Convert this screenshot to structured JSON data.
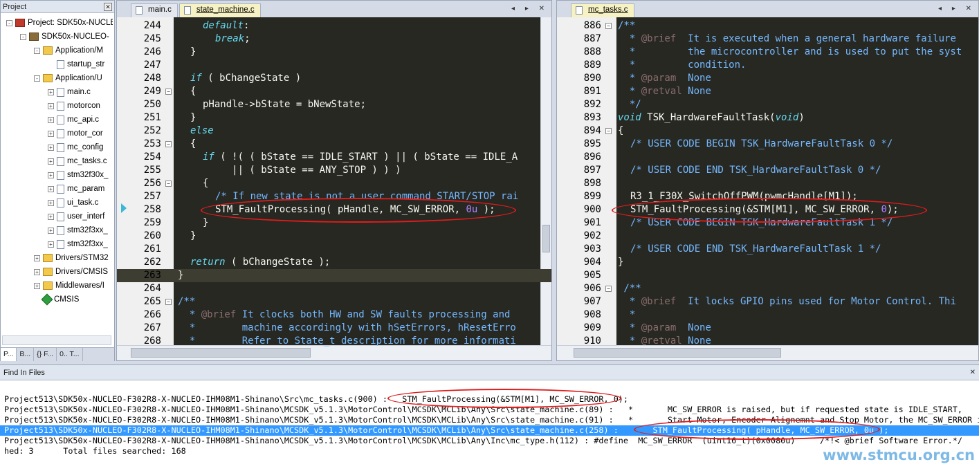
{
  "project_panel": {
    "title": "Project",
    "tree": [
      {
        "label": "Project: SDK50x-NUCLE",
        "depth": 0,
        "exp": "-",
        "icon": "proj"
      },
      {
        "label": "SDK50x-NUCLEO-",
        "depth": 1,
        "exp": "-",
        "icon": "target"
      },
      {
        "label": "Application/M",
        "depth": 2,
        "exp": "-",
        "icon": "folder"
      },
      {
        "label": "startup_str",
        "depth": 3,
        "exp": "",
        "icon": "file"
      },
      {
        "label": "Application/U",
        "depth": 2,
        "exp": "-",
        "icon": "folder"
      },
      {
        "label": "main.c",
        "depth": 3,
        "exp": "+",
        "icon": "file"
      },
      {
        "label": "motorcon",
        "depth": 3,
        "exp": "+",
        "icon": "file"
      },
      {
        "label": "mc_api.c",
        "depth": 3,
        "exp": "+",
        "icon": "file"
      },
      {
        "label": "motor_cor",
        "depth": 3,
        "exp": "+",
        "icon": "file"
      },
      {
        "label": "mc_config",
        "depth": 3,
        "exp": "+",
        "icon": "file"
      },
      {
        "label": "mc_tasks.c",
        "depth": 3,
        "exp": "+",
        "icon": "file"
      },
      {
        "label": "stm32f30x_",
        "depth": 3,
        "exp": "+",
        "icon": "file"
      },
      {
        "label": "mc_param",
        "depth": 3,
        "exp": "+",
        "icon": "file"
      },
      {
        "label": "ui_task.c",
        "depth": 3,
        "exp": "+",
        "icon": "file"
      },
      {
        "label": "user_interf",
        "depth": 3,
        "exp": "+",
        "icon": "file"
      },
      {
        "label": "stm32f3xx_",
        "depth": 3,
        "exp": "+",
        "icon": "file"
      },
      {
        "label": "stm32f3xx_",
        "depth": 3,
        "exp": "+",
        "icon": "file"
      },
      {
        "label": "Drivers/STM32",
        "depth": 2,
        "exp": "+",
        "icon": "folder"
      },
      {
        "label": "Drivers/CMSIS",
        "depth": 2,
        "exp": "+",
        "icon": "folder"
      },
      {
        "label": "Middlewares/I",
        "depth": 2,
        "exp": "+",
        "icon": "folder"
      },
      {
        "label": "CMSIS",
        "depth": 2,
        "exp": "",
        "icon": "gem"
      }
    ],
    "bottom_tabs": [
      "P...",
      "B...",
      "{} F...",
      "0.. T..."
    ]
  },
  "left_editor": {
    "tabs": [
      {
        "label": "main.c",
        "active": false
      },
      {
        "label": "state_machine.c",
        "active": true
      }
    ],
    "lines": [
      {
        "n": "244",
        "f": "",
        "h": "<span class='kw'>default</span>:",
        "i": 2
      },
      {
        "n": "245",
        "f": "",
        "h": "<span class='kw'>break</span>;",
        "i": 3
      },
      {
        "n": "246",
        "f": "",
        "h": "}",
        "i": 1
      },
      {
        "n": "247",
        "f": "",
        "h": "",
        "i": 0
      },
      {
        "n": "248",
        "f": "",
        "h": "<span class='kw'>if</span> ( bChangeState )",
        "i": 1
      },
      {
        "n": "249",
        "f": "-",
        "h": "{",
        "i": 1
      },
      {
        "n": "250",
        "f": "",
        "h": "pHandle-&gt;bState = bNewState;",
        "i": 2
      },
      {
        "n": "251",
        "f": "",
        "h": "}",
        "i": 1
      },
      {
        "n": "252",
        "f": "",
        "h": "<span class='kw'>else</span>",
        "i": 1
      },
      {
        "n": "253",
        "f": "-",
        "h": "{",
        "i": 1
      },
      {
        "n": "254",
        "f": "",
        "h": "<span class='kw'>if</span> ( !( ( bState == IDLE_START ) || ( bState == IDLE_A",
        "i": 2
      },
      {
        "n": "255",
        "f": "",
        "h": "     || ( bState == ANY_STOP ) ) )",
        "i": 2
      },
      {
        "n": "256",
        "f": "-",
        "h": "{",
        "i": 2
      },
      {
        "n": "257",
        "f": "",
        "h": "<span class='cm'>/* If new state is not a user command START/STOP rai</span>",
        "i": 3
      },
      {
        "n": "258",
        "f": "",
        "h": "STM_FaultProcessing( pHandle, MC_SW_ERROR, <span class='num'>0u</span> );",
        "i": 3
      },
      {
        "n": "259",
        "f": "",
        "h": "}",
        "i": 2
      },
      {
        "n": "260",
        "f": "",
        "h": "}",
        "i": 1
      },
      {
        "n": "261",
        "f": "",
        "h": "",
        "i": 0
      },
      {
        "n": "262",
        "f": "",
        "h": "<span class='kw'>return</span> ( bChangeState );",
        "i": 1
      },
      {
        "n": "263",
        "f": "",
        "h": "}",
        "i": 0
      },
      {
        "n": "264",
        "f": "",
        "h": "",
        "i": 0
      },
      {
        "n": "265",
        "f": "-",
        "h": "<span class='cm'>/**</span>",
        "i": 0
      },
      {
        "n": "266",
        "f": "",
        "h": "<span class='cm'>  * </span><span class='tag'>@brief</span><span class='cm'> It clocks both HW and SW faults processing and</span>",
        "i": 0
      },
      {
        "n": "267",
        "f": "",
        "h": "<span class='cm'>  *        machine accordingly with hSetErrors, hResetErro</span>",
        "i": 0
      },
      {
        "n": "268",
        "f": "",
        "h": "<span class='cm'>  *        Refer to State_t description for more informati</span>",
        "i": 0
      }
    ]
  },
  "right_editor": {
    "tabs": [
      {
        "label": "mc_tasks.c",
        "active": true
      }
    ],
    "lines": [
      {
        "n": "886",
        "f": "-",
        "h": "<span class='cm'>/**</span>",
        "i": 0
      },
      {
        "n": "887",
        "f": "",
        "h": "<span class='cm'>  * </span><span class='tag'>@brief</span><span class='cm'>  It is executed when a general hardware failure</span>",
        "i": 0
      },
      {
        "n": "888",
        "f": "",
        "h": "<span class='cm'>  *         the microcontroller and is used to put the syst</span>",
        "i": 0
      },
      {
        "n": "889",
        "f": "",
        "h": "<span class='cm'>  *         condition.</span>",
        "i": 0
      },
      {
        "n": "890",
        "f": "",
        "h": "<span class='cm'>  * </span><span class='tag'>@param</span><span class='cm'>  None</span>",
        "i": 0
      },
      {
        "n": "891",
        "f": "",
        "h": "<span class='cm'>  * </span><span class='tag'>@retval</span><span class='cm'> None</span>",
        "i": 0
      },
      {
        "n": "892",
        "f": "",
        "h": "<span class='cm'>  */</span>",
        "i": 0
      },
      {
        "n": "893",
        "f": "",
        "h": "<span class='kw'>void</span> TSK_HardwareFaultTask(<span class='kw'>void</span>)",
        "i": 0
      },
      {
        "n": "894",
        "f": "-",
        "h": "{",
        "i": 0
      },
      {
        "n": "895",
        "f": "",
        "h": "<span class='cm'>/* USER CODE BEGIN TSK_HardwareFaultTask 0 */</span>",
        "i": 1
      },
      {
        "n": "896",
        "f": "",
        "h": "",
        "i": 0
      },
      {
        "n": "897",
        "f": "",
        "h": "<span class='cm'>/* USER CODE END TSK_HardwareFaultTask 0 */</span>",
        "i": 1
      },
      {
        "n": "898",
        "f": "",
        "h": "",
        "i": 0
      },
      {
        "n": "899",
        "f": "",
        "h": "R3_1_F30X_SwitchOffPWM(pwmcHandle[M1]);",
        "i": 1
      },
      {
        "n": "900",
        "f": "",
        "h": "STM_FaultProcessing(&amp;STM[M1], MC_SW_ERROR, <span class='num'>0</span>);",
        "i": 1
      },
      {
        "n": "901",
        "f": "",
        "h": "<span class='cm'>/* USER CODE BEGIN TSK_HardwareFaultTask 1 */</span>",
        "i": 1
      },
      {
        "n": "902",
        "f": "",
        "h": "",
        "i": 0
      },
      {
        "n": "903",
        "f": "",
        "h": "<span class='cm'>/* USER CODE END TSK_HardwareFaultTask 1 */</span>",
        "i": 1
      },
      {
        "n": "904",
        "f": "",
        "h": "}",
        "i": 0
      },
      {
        "n": "905",
        "f": "",
        "h": "",
        "i": 0
      },
      {
        "n": "906",
        "f": "-",
        "h": "<span class='cm'> /**</span>",
        "i": 0
      },
      {
        "n": "907",
        "f": "",
        "h": "<span class='cm'>  * </span><span class='tag'>@brief</span><span class='cm'>  It locks GPIO pins used for Motor Control. Thi</span>",
        "i": 0
      },
      {
        "n": "908",
        "f": "",
        "h": "<span class='cm'>  *</span>",
        "i": 0
      },
      {
        "n": "909",
        "f": "",
        "h": "<span class='cm'>  * </span><span class='tag'>@param</span><span class='cm'>  None</span>",
        "i": 0
      },
      {
        "n": "910",
        "f": "",
        "h": "<span class='cm'>  * </span><span class='tag'>@retval</span><span class='cm'> None</span>",
        "i": 0
      }
    ]
  },
  "find_in_files": {
    "title": "Find In Files",
    "results": [
      {
        "text": "Project513\\SDK50x-NUCLEO-F302R8-X-NUCLEO-IHM08M1-Shinano\\Src\\mc_tasks.c(900) :   STM_FaultProcessing(&STM[M1], MC_SW_ERROR, 0);",
        "sel": false
      },
      {
        "text": "Project513\\SDK50x-NUCLEO-F302R8-X-NUCLEO-IHM08M1-Shinano\\MCSDK_v5.1.3\\MotorControl\\MCSDK\\MCLib\\Any\\Src\\state_machine.c(89) :   *       MC_SW_ERROR is raised, but if requested state is IDLE_START,",
        "sel": false
      },
      {
        "text": "Project513\\SDK50x-NUCLEO-F302R8-X-NUCLEO-IHM08M1-Shinano\\MCSDK_v5.1.3\\MotorControl\\MCSDK\\MCLib\\Any\\Src\\state_machine.c(91) :   *       Start Motor, Encoder Alignemnt and Stop Motor, the MC_SW_ERROR is",
        "sel": false
      },
      {
        "text": "Project513\\SDK50x-NUCLEO-F302R8-X-NUCLEO-IHM08M1-Shinano\\MCSDK_v5.1.3\\MotorControl\\MCSDK\\MCLib\\Any\\Src\\state_machine.c(258) :       STM_FaultProcessing( pHandle, MC_SW_ERROR, 0u );",
        "sel": true
      },
      {
        "text": "Project513\\SDK50x-NUCLEO-F302R8-X-NUCLEO-IHM08M1-Shinano\\MCSDK_v5.1.3\\MotorControl\\MCSDK\\MCLib\\Any\\Inc\\mc_type.h(112) : #define  MC_SW_ERROR  (uint16_t)(0x0080u)     /*!< @brief Software Error.*/",
        "sel": false
      },
      {
        "text": "hed: 3      Total files searched: 168",
        "sel": false
      }
    ]
  },
  "watermark": "www.stmcu.org.cn"
}
